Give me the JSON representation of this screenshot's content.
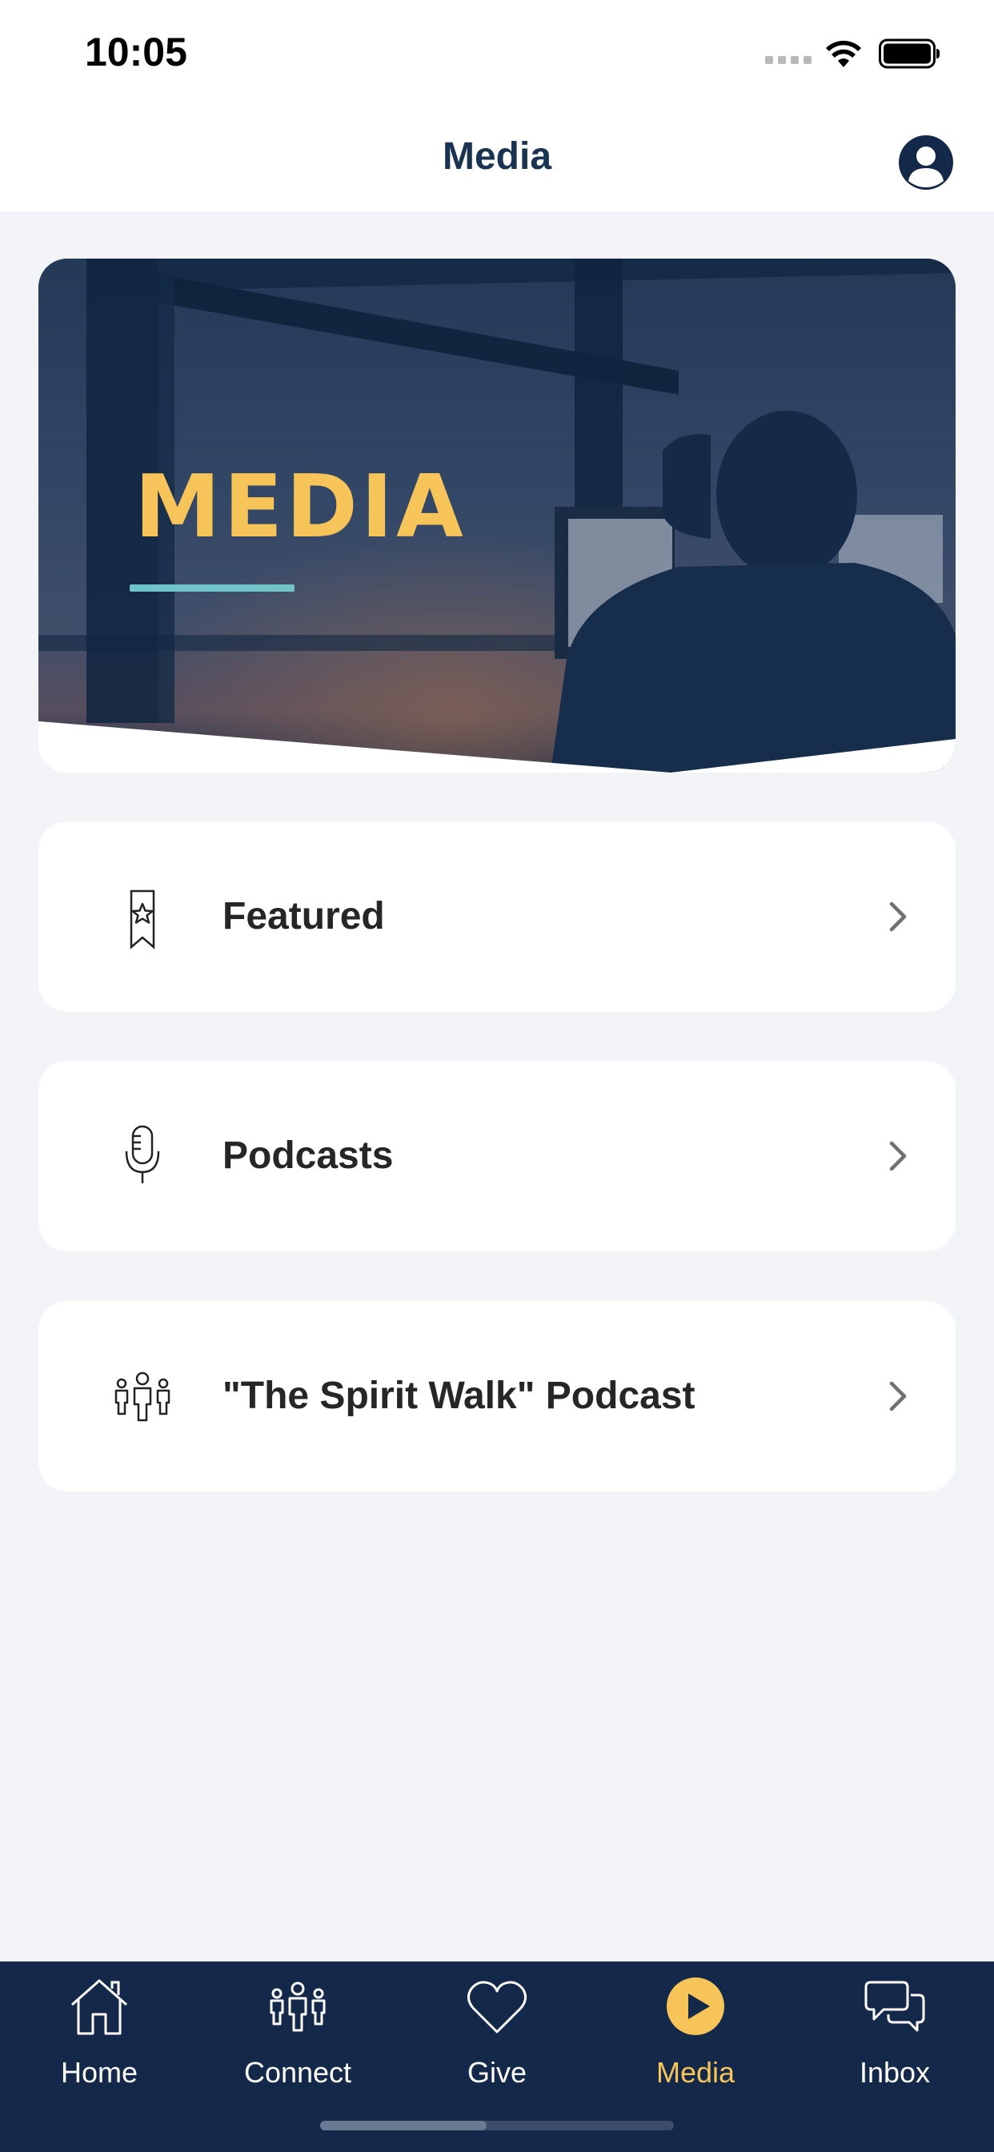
{
  "status_bar": {
    "time": "10:05"
  },
  "header": {
    "title": "Media"
  },
  "hero": {
    "title": "MEDIA"
  },
  "menu": [
    {
      "label": "Featured",
      "icon": "bookmark-star-icon"
    },
    {
      "label": "Podcasts",
      "icon": "microphone-icon"
    },
    {
      "label": "\"The Spirit Walk\" Podcast",
      "icon": "people-group-icon"
    }
  ],
  "tabs": [
    {
      "label": "Home",
      "icon": "home-icon"
    },
    {
      "label": "Connect",
      "icon": "people-icon"
    },
    {
      "label": "Give",
      "icon": "heart-icon"
    },
    {
      "label": "Media",
      "icon": "play-icon",
      "active": true
    },
    {
      "label": "Inbox",
      "icon": "chat-bubbles-icon"
    }
  ],
  "colors": {
    "accent": "#f6c458",
    "navy": "#14294a",
    "title": "#1a3350",
    "teal": "#6fc4c8",
    "background": "#f3f4f8"
  }
}
